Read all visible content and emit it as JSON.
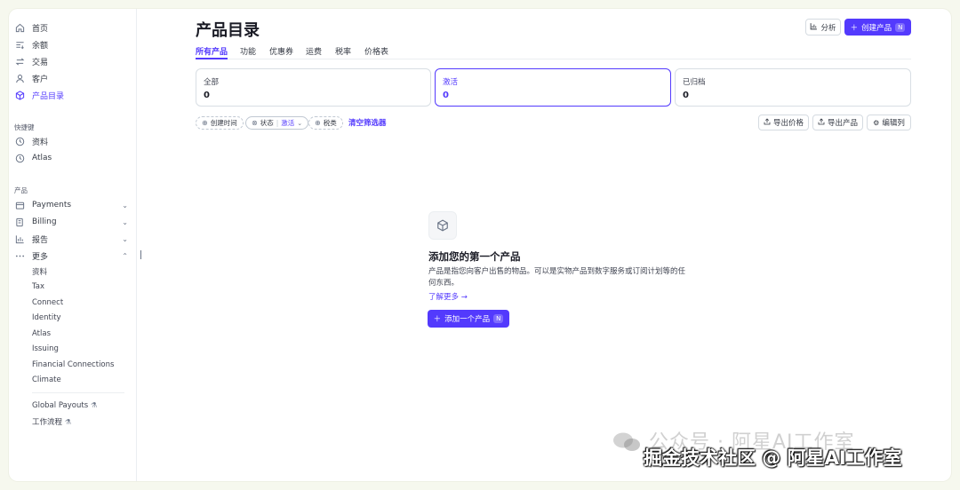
{
  "sidebar": {
    "main_items": [
      {
        "label": "首页",
        "icon": "home-icon"
      },
      {
        "label": "余额",
        "icon": "balance-icon"
      },
      {
        "label": "交易",
        "icon": "transactions-icon"
      },
      {
        "label": "客户",
        "icon": "customer-icon"
      },
      {
        "label": "产品目录",
        "icon": "product-box-icon",
        "active": true
      }
    ],
    "shortcuts_title": "快捷键",
    "shortcuts": [
      {
        "label": "资料",
        "icon": "clock-icon"
      },
      {
        "label": "Atlas",
        "icon": "clock-icon"
      }
    ],
    "products_title": "产品",
    "product_items": [
      {
        "label": "Payments",
        "icon": "payments-icon"
      },
      {
        "label": "Billing",
        "icon": "billing-icon"
      },
      {
        "label": "报告",
        "icon": "report-icon"
      },
      {
        "label": "更多",
        "icon": "more-icon"
      }
    ],
    "more_items": [
      "资料",
      "Tax",
      "Connect",
      "Identity",
      "Atlas",
      "Issuing",
      "Financial Connections",
      "Climate"
    ],
    "labs_items": [
      "Global Payouts",
      "工作流程"
    ]
  },
  "header": {
    "title": "产品目录",
    "analysis_label": "分析",
    "create_label": "创建产品",
    "create_shortcut": "N"
  },
  "tabs": [
    "所有产品",
    "功能",
    "优惠券",
    "运费",
    "税率",
    "价格表"
  ],
  "status_cards": [
    {
      "label": "全部",
      "count": "0"
    },
    {
      "label": "激活",
      "count": "0"
    },
    {
      "label": "已归档",
      "count": "0"
    }
  ],
  "filters": {
    "created": "创建时间",
    "status": "状态",
    "status_value": "激活",
    "tax": "税类",
    "clear": "清空筛选器"
  },
  "tools": {
    "export_prices": "导出价格",
    "export_products": "导出产品",
    "edit_columns": "编辑列"
  },
  "empty_state": {
    "title": "添加您的第一个产品",
    "description": "产品是指您向客户出售的物品。可以是实物产品到数字服务或订阅计划等的任何东西。",
    "learn_more": "了解更多 →",
    "add_label": "添加一个产品",
    "add_shortcut": "N"
  },
  "watermark": {
    "line1": "公众号 · 阿星AI工作室",
    "line2": "掘金技术社区 @ 阿星AI工作室"
  },
  "colors": {
    "accent": "#533afd",
    "text": "#353a44",
    "border": "#d8dee4"
  }
}
